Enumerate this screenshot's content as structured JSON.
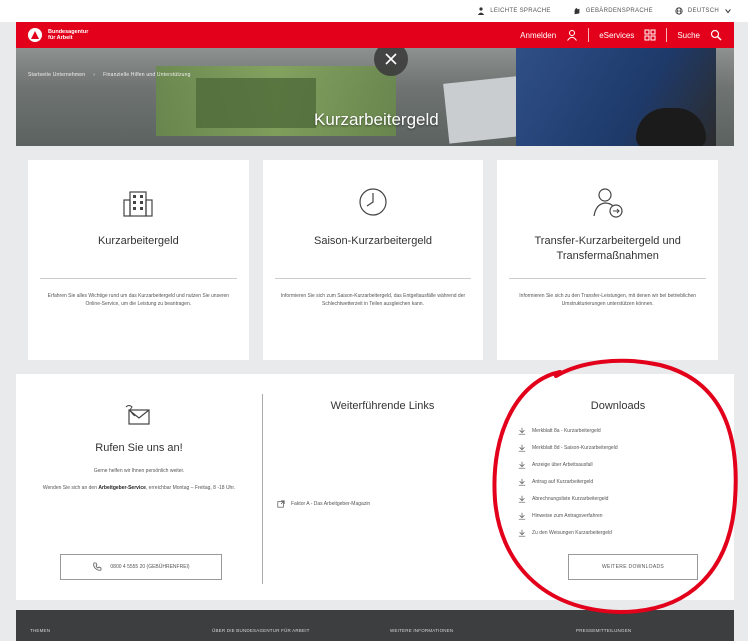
{
  "utility": {
    "items": [
      {
        "icon": "person-icon",
        "label": "LEICHTE SPRACHE"
      },
      {
        "icon": "hand-sign-icon",
        "label": "GEBÄRDENSPRACHE"
      },
      {
        "icon": "globe-icon",
        "label": "DEUTSCH"
      }
    ]
  },
  "header": {
    "logo_line1": "Bundesagentur",
    "logo_line2": "für Arbeit",
    "login": "Anmelden",
    "eservices": "eServices",
    "search": "Suche",
    "brand_color": "#e2001a"
  },
  "hero": {
    "breadcrumb": [
      "Startseite Unternehmen",
      "Finanzielle Hilfen und Unterstützung"
    ],
    "title": "Kurzarbeitergeld"
  },
  "cards": [
    {
      "icon": "building-icon",
      "title": "Kurzarbeitergeld",
      "desc": "Erfahren Sie alles Wichtige rund um das Kurzarbeitergeld und nutzen Sie unseren Online-Service, um die Leistung zu beantragen."
    },
    {
      "icon": "clock-icon",
      "title": "Saison-Kurzarbeitergeld",
      "desc": "Informieren Sie sich zum Saison-Kurzarbeitergeld, das Entgeltausfälle während der Schlechtwetterzeit in Teilen ausgleichen kann."
    },
    {
      "icon": "person-transfer-icon",
      "title": "Transfer-Kurzarbeitergeld und Transfermaßnahmen",
      "desc": "Informieren Sie sich zu den Transfer-Leistungen, mit denen wir bei betrieblichen Umstrukturierungen unterstützen können."
    }
  ],
  "contact": {
    "title": "Rufen Sie uns an!",
    "p1": "Gerne helfen wir Ihnen persönlich weiter.",
    "p2_before": "Wenden Sie sich an den ",
    "p2_bold": "Arbeitgeber-Service",
    "p2_after": ", erreichbar Montag – Freitag, 8 -18 Uhr.",
    "phone": "0800 4 5555 20 (GEBÜHRENFREI)"
  },
  "links": {
    "title": "Weiterführende Links",
    "items": [
      "Faktor A - Das Arbeitgeber-Magazin"
    ]
  },
  "downloads": {
    "title": "Downloads",
    "items": [
      "Merkblatt 8a - Kurzarbeitergeld",
      "Merkblatt 8d - Saison-Kurzarbeitergeld",
      "Anzeige über Arbeitsausfall",
      "Antrag auf Kurzarbeitergeld",
      "Abrechnungsliste Kurzarbeitergeld",
      "Hinweise zum Antragsverfahren",
      "Zu den Weisungen Kurzarbeitergeld"
    ],
    "more": "WEITERE DOWNLOADS"
  },
  "footer": {
    "items": [
      "THEMEN",
      "ÜBER DIE BUNDESAGENTUR FÜR ARBEIT",
      "WEITERE INFORMATIONEN",
      "PRESSEMITTEILUNGEN"
    ]
  },
  "annotation_color": "#e3001b"
}
